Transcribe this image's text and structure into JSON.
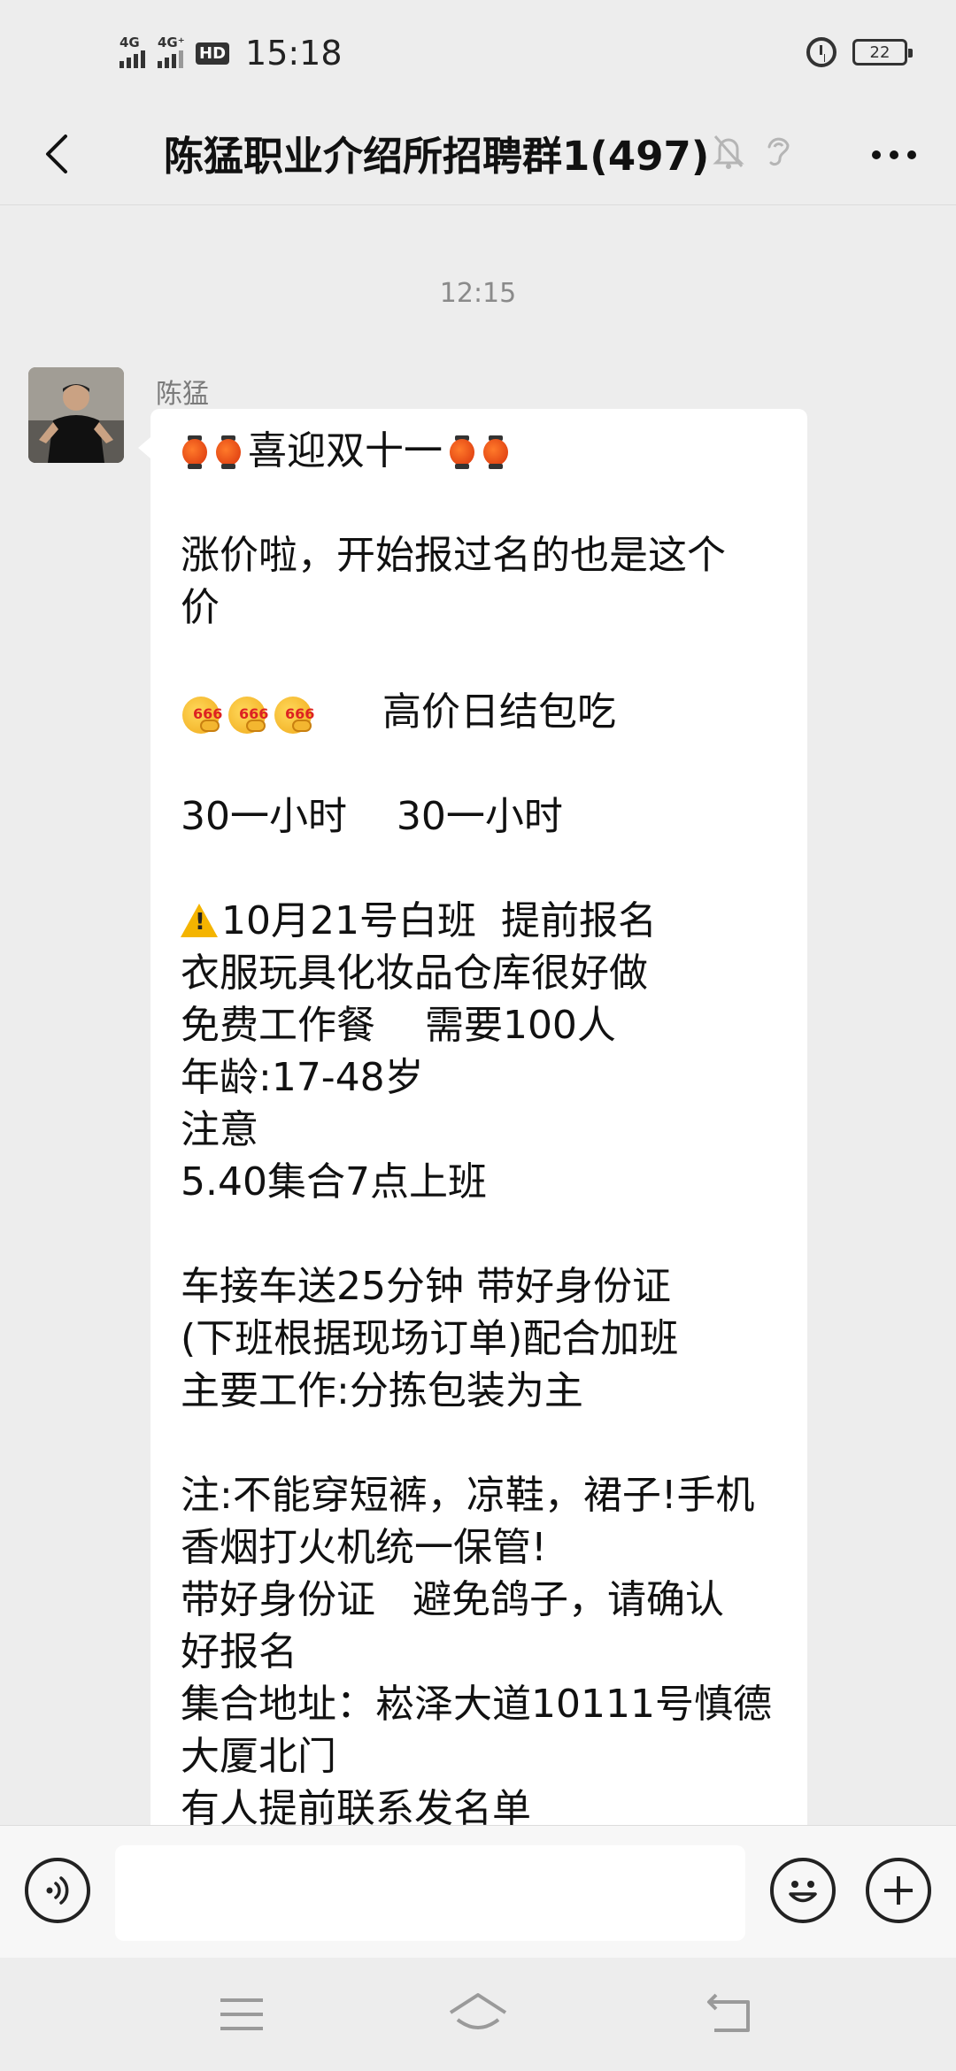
{
  "status_bar": {
    "signal1": "4G",
    "signal2": "4G⁺",
    "hd": "HD",
    "time": "15:18",
    "battery": "22"
  },
  "header": {
    "title": "陈猛职业介绍所招聘群1(497)"
  },
  "chat": {
    "timestamp": "12:15",
    "message": {
      "sender": "陈猛",
      "lines": [
        "喜迎双十一",
        "",
        "涨价啦，开始报过名的也是这个",
        "价",
        "",
        "高价日结包吃",
        "",
        "30一小时    30一小时",
        "",
        "10月21号白班  提前报名",
        "衣服玩具化妆品仓库很好做",
        "免费工作餐    需要100人",
        "年龄:17-48岁",
        "注意",
        "5.40集合7点上班",
        "",
        "车接车送25分钟 带好身份证",
        "(下班根据现场订单)配合加班",
        "主要工作:分拣包装为主",
        "",
        "注:不能穿短裤，凉鞋，裙子!手机",
        "香烟打火机统一保管!",
        "带好身份证   避免鸽子，请确认",
        "好报名",
        "集合地址：崧泽大道10111号慎德",
        "大厦北门",
        "有人提前联系发名单"
      ]
    }
  },
  "input": {
    "placeholder": ""
  },
  "icons": {
    "back": "back-arrow-icon",
    "mute": "bell-off-icon",
    "ear": "ear-icon",
    "more": "more-dots-icon",
    "voice": "voice-icon",
    "emoji": "emoji-icon",
    "plus": "plus-icon",
    "menu": "menu-icon",
    "home": "home-icon",
    "return": "return-icon"
  }
}
